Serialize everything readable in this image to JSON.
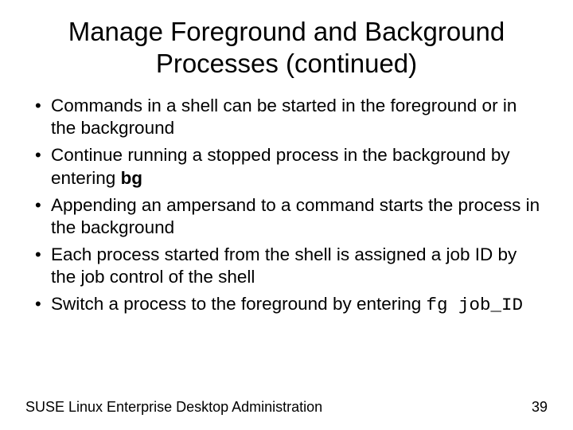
{
  "title_line1": "Manage Foreground and Background",
  "title_line2": "Processes (continued)",
  "bullets": {
    "b0": "Commands in a shell can be started in the foreground or in the background",
    "b1_pre": "Continue running a stopped process in the background by entering ",
    "b1_bold": "bg",
    "b2": "Appending an ampersand to a command starts the process in the background",
    "b3": "Each process started from the shell is assigned a job ID by the job control of the shell",
    "b4_pre": "Switch a process to the foreground by entering ",
    "b4_code": "fg job_ID"
  },
  "footer_left": "SUSE Linux Enterprise Desktop Administration",
  "footer_right": "39"
}
